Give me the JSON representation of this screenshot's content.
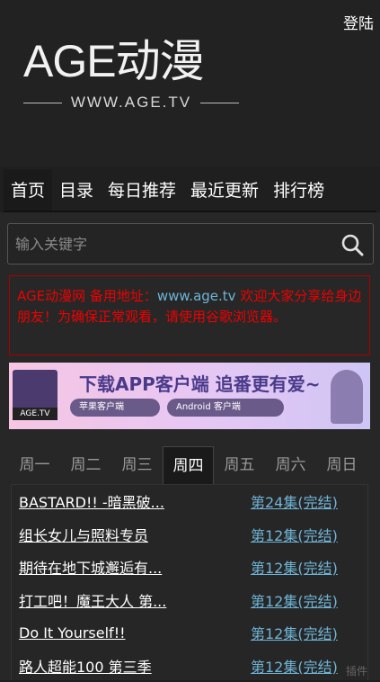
{
  "header": {
    "login_label": "登陆",
    "logo_main": "AGE动漫",
    "logo_sub": "WWW.AGE.TV"
  },
  "nav": [
    {
      "label": "首页"
    },
    {
      "label": "目录"
    },
    {
      "label": "每日推荐"
    },
    {
      "label": "最近更新"
    },
    {
      "label": "排行榜"
    }
  ],
  "search": {
    "placeholder": "输入关键字",
    "icon": "search-icon"
  },
  "notice": {
    "text_before": "AGE动漫网 备用地址：",
    "url": "www.age.tv",
    "text_after": " 欢迎大家分享给身边朋友！为确保正常观看，请使用谷歌浏览器。"
  },
  "banner": {
    "title": "下载APP客户端 追番更有爱~",
    "ios_label": "苹果客户端",
    "android_label": "Android 客户端",
    "avatar_label": "AGE.TV"
  },
  "week": [
    {
      "label": "周一"
    },
    {
      "label": "周二"
    },
    {
      "label": "周三"
    },
    {
      "label": "周四"
    },
    {
      "label": "周五"
    },
    {
      "label": "周六"
    },
    {
      "label": "周日"
    }
  ],
  "list": [
    {
      "title": "BASTARD!! -暗黑破...",
      "episode": "第24集(完结)"
    },
    {
      "title": "组长女儿与照料专员",
      "episode": "第12集(完结)"
    },
    {
      "title": "期待在地下城邂逅有...",
      "episode": "第12集(完结)"
    },
    {
      "title": "打工吧！魔王大人 第...",
      "episode": "第12集(完结)"
    },
    {
      "title": "Do It Yourself!!",
      "episode": "第12集(完结)"
    },
    {
      "title": "路人超能100 第三季",
      "episode": "第12集(完结)"
    }
  ],
  "watermark": "插件",
  "colors": {
    "background": "#1f1f1f",
    "notice_red": "#e00000",
    "link_blue": "#6fb4d6"
  }
}
